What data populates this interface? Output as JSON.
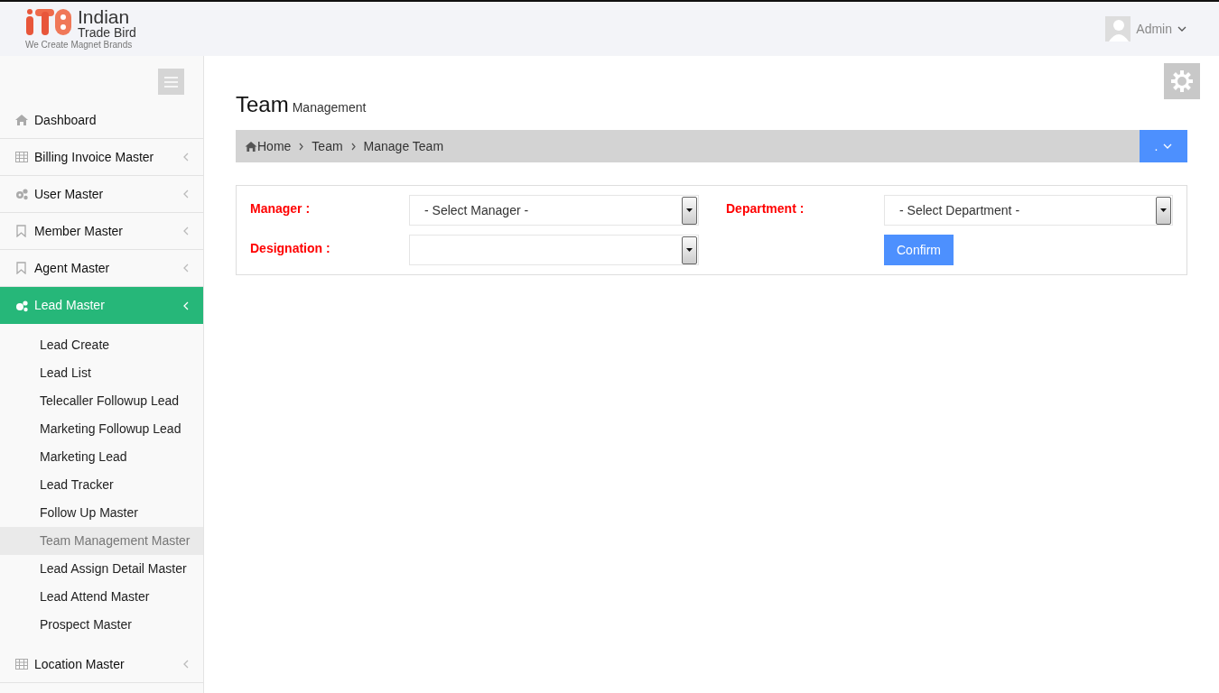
{
  "header": {
    "brand_name": "Indian",
    "brand_sub": "Trade Bird",
    "tagline": "We Create Magnet Brands",
    "user": "Admin"
  },
  "sidebar": {
    "items": [
      {
        "label": "Dashboard",
        "kind": "home",
        "expandable": false,
        "selected": false
      },
      {
        "label": "Billing Invoice Master",
        "kind": "table",
        "expandable": true,
        "selected": false
      },
      {
        "label": "User Master",
        "kind": "gears",
        "expandable": true,
        "selected": false
      },
      {
        "label": "Member Master",
        "kind": "bookmark",
        "expandable": true,
        "selected": false
      },
      {
        "label": "Agent Master",
        "kind": "bookmark",
        "expandable": true,
        "selected": false
      },
      {
        "label": "Lead Master",
        "kind": "gears",
        "expandable": true,
        "selected": true,
        "children": [
          {
            "label": "Lead Create",
            "selected": false
          },
          {
            "label": "Lead List",
            "selected": false
          },
          {
            "label": "Telecaller Followup Lead",
            "selected": false
          },
          {
            "label": "Marketing Followup Lead",
            "selected": false
          },
          {
            "label": "Marketing Lead",
            "selected": false
          },
          {
            "label": "Lead Tracker",
            "selected": false
          },
          {
            "label": "Follow Up Master",
            "selected": false
          },
          {
            "label": "Team Management Master",
            "selected": true
          },
          {
            "label": "Lead Assign Detail Master",
            "selected": false
          },
          {
            "label": "Lead Attend Master",
            "selected": false
          },
          {
            "label": "Prospect Master",
            "selected": false
          }
        ]
      },
      {
        "label": "Location Master",
        "kind": "table",
        "expandable": true,
        "selected": false
      }
    ]
  },
  "page": {
    "title": "Team",
    "subtitle": "Management"
  },
  "breadcrumb": {
    "items": [
      "Home",
      "Team",
      "Manage Team"
    ],
    "action": "."
  },
  "form": {
    "fields": [
      {
        "label": "Manager :",
        "value": "- Select Manager -"
      },
      {
        "label": "Department :",
        "value": "- Select Department -"
      },
      {
        "label": "Designation :"
      }
    ],
    "button": "Confirm"
  }
}
